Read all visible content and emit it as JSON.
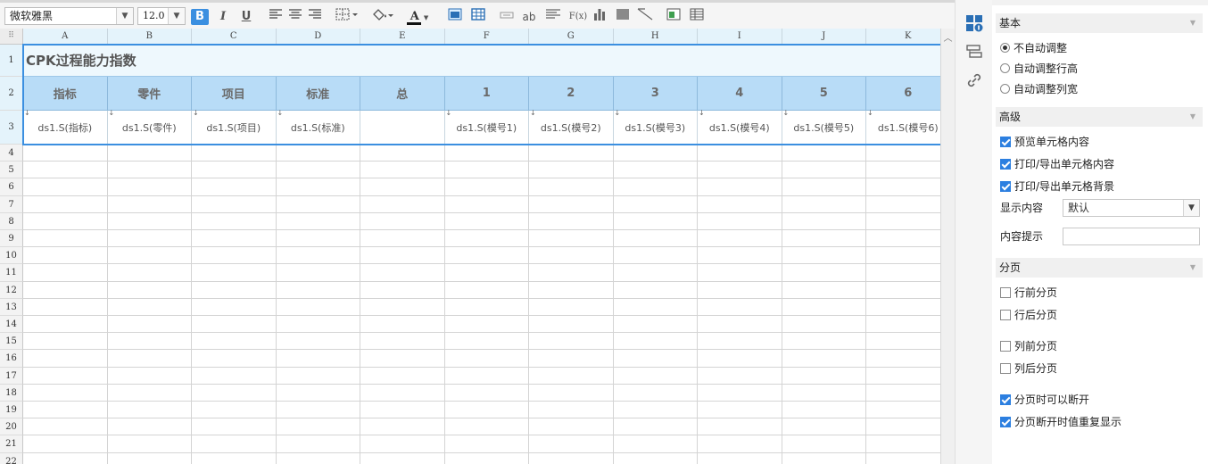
{
  "toolbar": {
    "font_name": "微软雅黑",
    "font_size": "12.0",
    "bold_label": "B",
    "italic_label": "I",
    "underline_label": "U",
    "text_color_label": "A",
    "wrap_label": "ab",
    "formula_label": "F(x)"
  },
  "columns": [
    "A",
    "B",
    "C",
    "D",
    "E",
    "F",
    "G",
    "H",
    "I",
    "J",
    "K"
  ],
  "rows": [
    "1",
    "2",
    "3",
    "4",
    "5",
    "6",
    "7",
    "8",
    "9",
    "10",
    "11",
    "12",
    "13",
    "14",
    "15",
    "16",
    "17",
    "18",
    "19",
    "20",
    "21",
    "22"
  ],
  "sheet": {
    "title": "CPK过程能力指数",
    "header_cells": [
      "指标",
      "零件",
      "项目",
      "标准",
      "总",
      "1",
      "2",
      "3",
      "4",
      "5",
      "6"
    ],
    "data_cells": [
      "ds1.S(指标)",
      "ds1.S(零件)",
      "ds1.S(项目)",
      "ds1.S(标准)",
      "",
      "ds1.S(模号1)",
      "ds1.S(模号2)",
      "ds1.S(模号3)",
      "ds1.S(模号4)",
      "ds1.S(模号5)",
      "ds1.S(模号6)"
    ]
  },
  "panel": {
    "basic": {
      "title": "基本",
      "options": [
        {
          "label": "不自动调整",
          "selected": true
        },
        {
          "label": "自动调整行高",
          "selected": false
        },
        {
          "label": "自动调整列宽",
          "selected": false
        }
      ]
    },
    "advanced": {
      "title": "高级",
      "checks": [
        {
          "label": "预览单元格内容",
          "checked": true
        },
        {
          "label": "打印/导出单元格内容",
          "checked": true
        },
        {
          "label": "打印/导出单元格背景",
          "checked": true
        }
      ],
      "display_label": "显示内容",
      "display_value": "默认",
      "tip_label": "内容提示",
      "tip_value": ""
    },
    "paging": {
      "title": "分页",
      "checks": [
        {
          "label": "行前分页",
          "checked": false
        },
        {
          "label": "行后分页",
          "checked": false
        },
        {
          "label": "列前分页",
          "checked": false
        },
        {
          "label": "列后分页",
          "checked": false
        },
        {
          "label": "分页时可以断开",
          "checked": true
        },
        {
          "label": "分页断开时值重复显示",
          "checked": true
        }
      ]
    }
  },
  "colors": {
    "accent": "#3b8fe0",
    "header_fill": "#b8dcf7",
    "title_fill": "#eef8fd",
    "column_header": "#e4f3fb"
  }
}
